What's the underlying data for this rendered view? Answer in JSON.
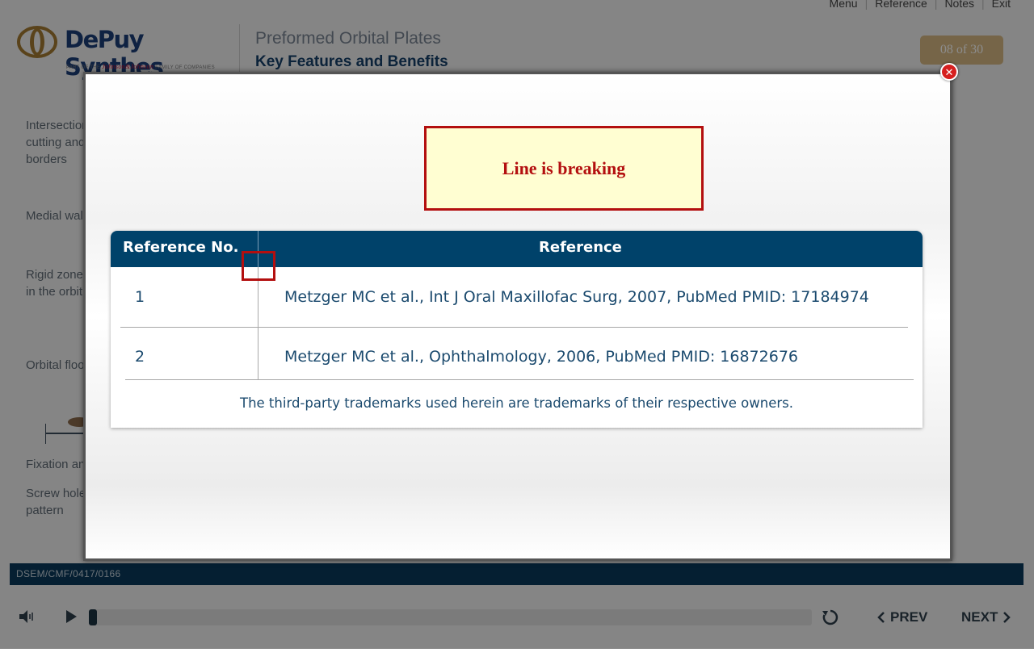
{
  "topnav": {
    "menu": "Menu",
    "reference": "Reference",
    "notes": "Notes",
    "exit": "Exit"
  },
  "brand": {
    "name": "DePuy Synthes",
    "tagline_pre": "PART OF THE ",
    "tagline_jj": "Johnson&Johnson",
    "tagline_post": " FAMILY OF COMPANIES"
  },
  "slide": {
    "title": "Preformed Orbital Plates",
    "subtitle": "Key Features and Benefits",
    "counter": "08 of 30"
  },
  "left_list": [
    "Intersection cutting and borders",
    "Medial wall",
    "Rigid zone form in the orbit",
    "Orbital floor",
    "Fixation and",
    "Screw hole pattern"
  ],
  "annotation": {
    "text": "Line is breaking"
  },
  "reference_table": {
    "header_no": "Reference No.",
    "header_ref": "Reference",
    "rows": [
      {
        "no": "1",
        "ref": "Metzger MC et al., Int J Oral Maxillofac Surg, 2007, PubMed PMID: 17184974"
      },
      {
        "no": "2",
        "ref": "Metzger MC et al., Ophthalmology, 2006, PubMed PMID: 16872676"
      }
    ],
    "trademark_note": "The third-party trademarks used herein are trademarks of their respective owners."
  },
  "footer": {
    "code": "DSEM/CMF/0417/0166"
  },
  "controls": {
    "prev": "PREV",
    "next": "NEXT",
    "progress": 0.0
  },
  "icons": {
    "close": "close-icon",
    "volume": "volume-icon",
    "play": "play-icon",
    "replay": "replay-icon",
    "prev": "chevron-left-icon",
    "next": "chevron-right-icon"
  },
  "colors": {
    "header_blue": "#00426a",
    "counter_gold": "#d7b984",
    "annotation_red": "#b30f0f",
    "annotation_bg": "#fffed2",
    "close_red": "#d6201f"
  }
}
